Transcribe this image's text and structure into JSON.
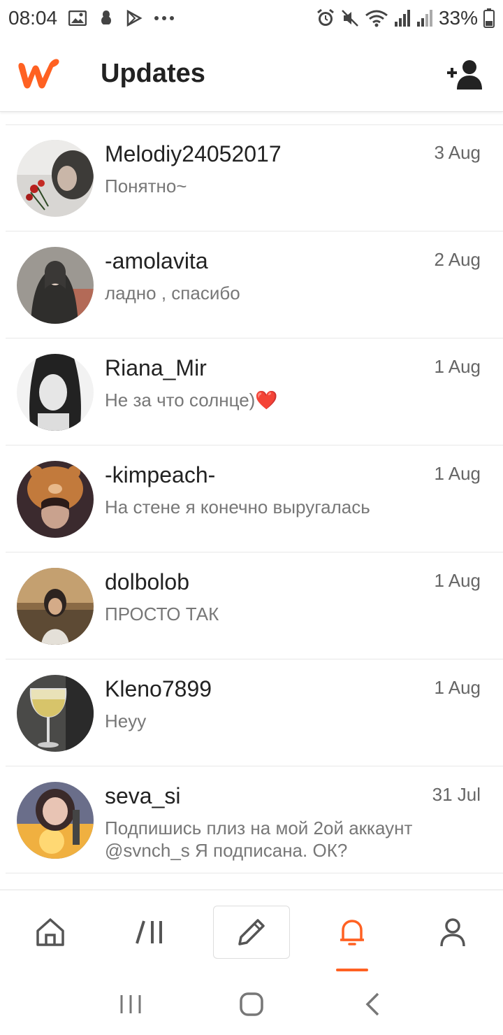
{
  "status_bar": {
    "time": "08:04",
    "battery": "33%",
    "left_icons": [
      "image-icon",
      "app-icon",
      "play-store-icon",
      "more-dots-icon"
    ],
    "right_icons": [
      "alarm-icon",
      "mute-icon",
      "wifi-icon",
      "signal-icon",
      "signal-icon-2",
      "battery-icon"
    ]
  },
  "header": {
    "title": "Updates",
    "logo": "wattpad-logo-icon",
    "add_user_icon": "add-user-icon"
  },
  "brand_color": "#ff6122",
  "messages": [
    {
      "username": "Melodiy24052017",
      "date": "3 Aug",
      "preview": "Понятно~"
    },
    {
      "username": "-amolavita",
      "date": "2 Aug",
      "preview": "ладно , спасибо"
    },
    {
      "username": "Riana_Mir",
      "date": "1 Aug",
      "preview": "Не за что солнце)❤️"
    },
    {
      "username": "-kimpeach-",
      "date": "1 Aug",
      "preview": "На стене я конечно выругалась"
    },
    {
      "username": "dolbolob",
      "date": "1 Aug",
      "preview": "ПРОСТО ТАК"
    },
    {
      "username": "Kleno7899",
      "date": "1 Aug",
      "preview": "Heyy"
    },
    {
      "username": "seva_si",
      "date": "31 Jul",
      "preview": "Подпишись плиз на мой 2ой аккаунт @svnch_s Я подписана. ОК?"
    }
  ],
  "bottom_nav": {
    "items": [
      "home-icon",
      "library-icon",
      "write-icon",
      "notifications-icon",
      "profile-icon"
    ],
    "active": "notifications-icon"
  },
  "system_nav": [
    "recents-icon",
    "home-circle-icon",
    "back-icon"
  ]
}
